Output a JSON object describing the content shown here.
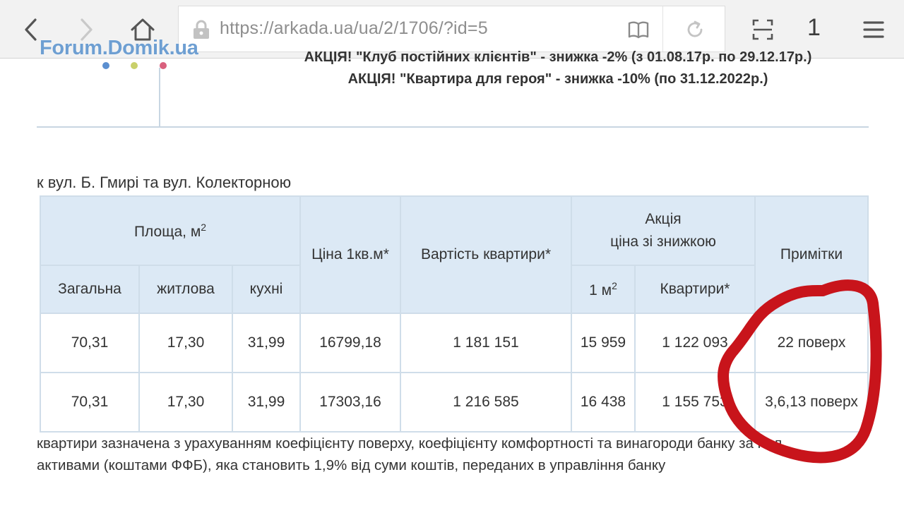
{
  "browser": {
    "url": "https://arkada.ua/ua/2/1706/?id=5",
    "tab_count": "1",
    "watermark": "Forum.Domik.ua",
    "icons": [
      "back-arrow-icon",
      "forward-arrow-icon",
      "home-icon",
      "lock-icon",
      "reader-mode-icon",
      "reload-icon",
      "fullscreen-icon",
      "menu-icon"
    ]
  },
  "page": {
    "promo_line_1": "АКЦІЯ! \"Клуб постійних клієнтів\" - знижка -2% (з 01.08.17р. по 29.12.17р.)",
    "promo_line_2": "АКЦІЯ! \"Квартира для героя\" - знижка -10% (по 31.12.2022р.)",
    "address": "к вул. Б. Гмирі та вул. Колекторною",
    "dot_colors": [
      "#5b8fd0",
      "#c9d06a",
      "#d9607d"
    ],
    "footnote_line_1": "квартири зазначена з урахуванням коефіцієнту поверху, коефіцієнту комфортності та винагороди банку за нал",
    "footnote_line_2": "активами (коштами ФФБ), яка становить 1,9% від суми коштів, переданих в управління банку"
  },
  "table": {
    "headers": {
      "area": "Площа, м",
      "area_sup": "2",
      "price_sqm": "Ціна 1кв.м*",
      "apartment_cost": "Вартість квартири*",
      "promo_line_1": "Акція",
      "promo_line_2": "ціна зі знижкою",
      "notes": "Примітки",
      "total": "Загальна",
      "living": "житлова",
      "kitchen": "кухні",
      "per_sqm": "1 м",
      "per_sqm_sup": "2",
      "apartment": "Квартири*"
    },
    "rows": [
      {
        "total": "70,31",
        "living": "17,30",
        "kitchen": "31,99",
        "price_sqm": "16799,18",
        "cost": "1 181 151",
        "promo_sqm": "15 959",
        "promo_apartment": "1 122 093",
        "note": "22 поверх"
      },
      {
        "total": "70,31",
        "living": "17,30",
        "kitchen": "31,99",
        "price_sqm": "17303,16",
        "cost": "1 216 585",
        "promo_sqm": "16 438",
        "promo_apartment": "1 155 753",
        "note": "3,6,13 поверх"
      }
    ]
  },
  "annotation": {
    "color": "#c8141b",
    "shape": "hand-drawn red circle around notes column"
  }
}
